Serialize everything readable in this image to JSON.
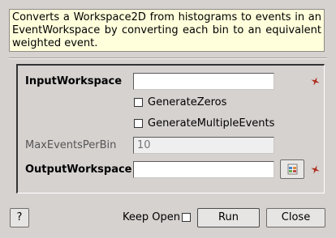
{
  "description": "Converts a Workspace2D from histograms to events in an EventWorkspace by converting each bin to an equivalent weighted event.",
  "form": {
    "input_workspace_label": "InputWorkspace",
    "input_workspace_value": "",
    "generate_zeros_label": "GenerateZeros",
    "generate_zeros_checked": false,
    "generate_multiple_events_label": "GenerateMultipleEvents",
    "generate_multiple_events_checked": false,
    "max_events_label": "MaxEventsPerBin",
    "max_events_placeholder": "10",
    "output_workspace_label": "OutputWorkspace",
    "output_workspace_value": ""
  },
  "footer": {
    "help_label": "?",
    "keep_open_label": "Keep Open",
    "keep_open_checked": false,
    "run_label": "Run",
    "close_label": "Close"
  },
  "icons": {
    "required": "required-star-icon",
    "browse": "workspace-browse-icon"
  },
  "colors": {
    "tooltip_bg": "#ffffdc",
    "required_star": "#b03020",
    "window_bg": "#d6d2d0"
  }
}
